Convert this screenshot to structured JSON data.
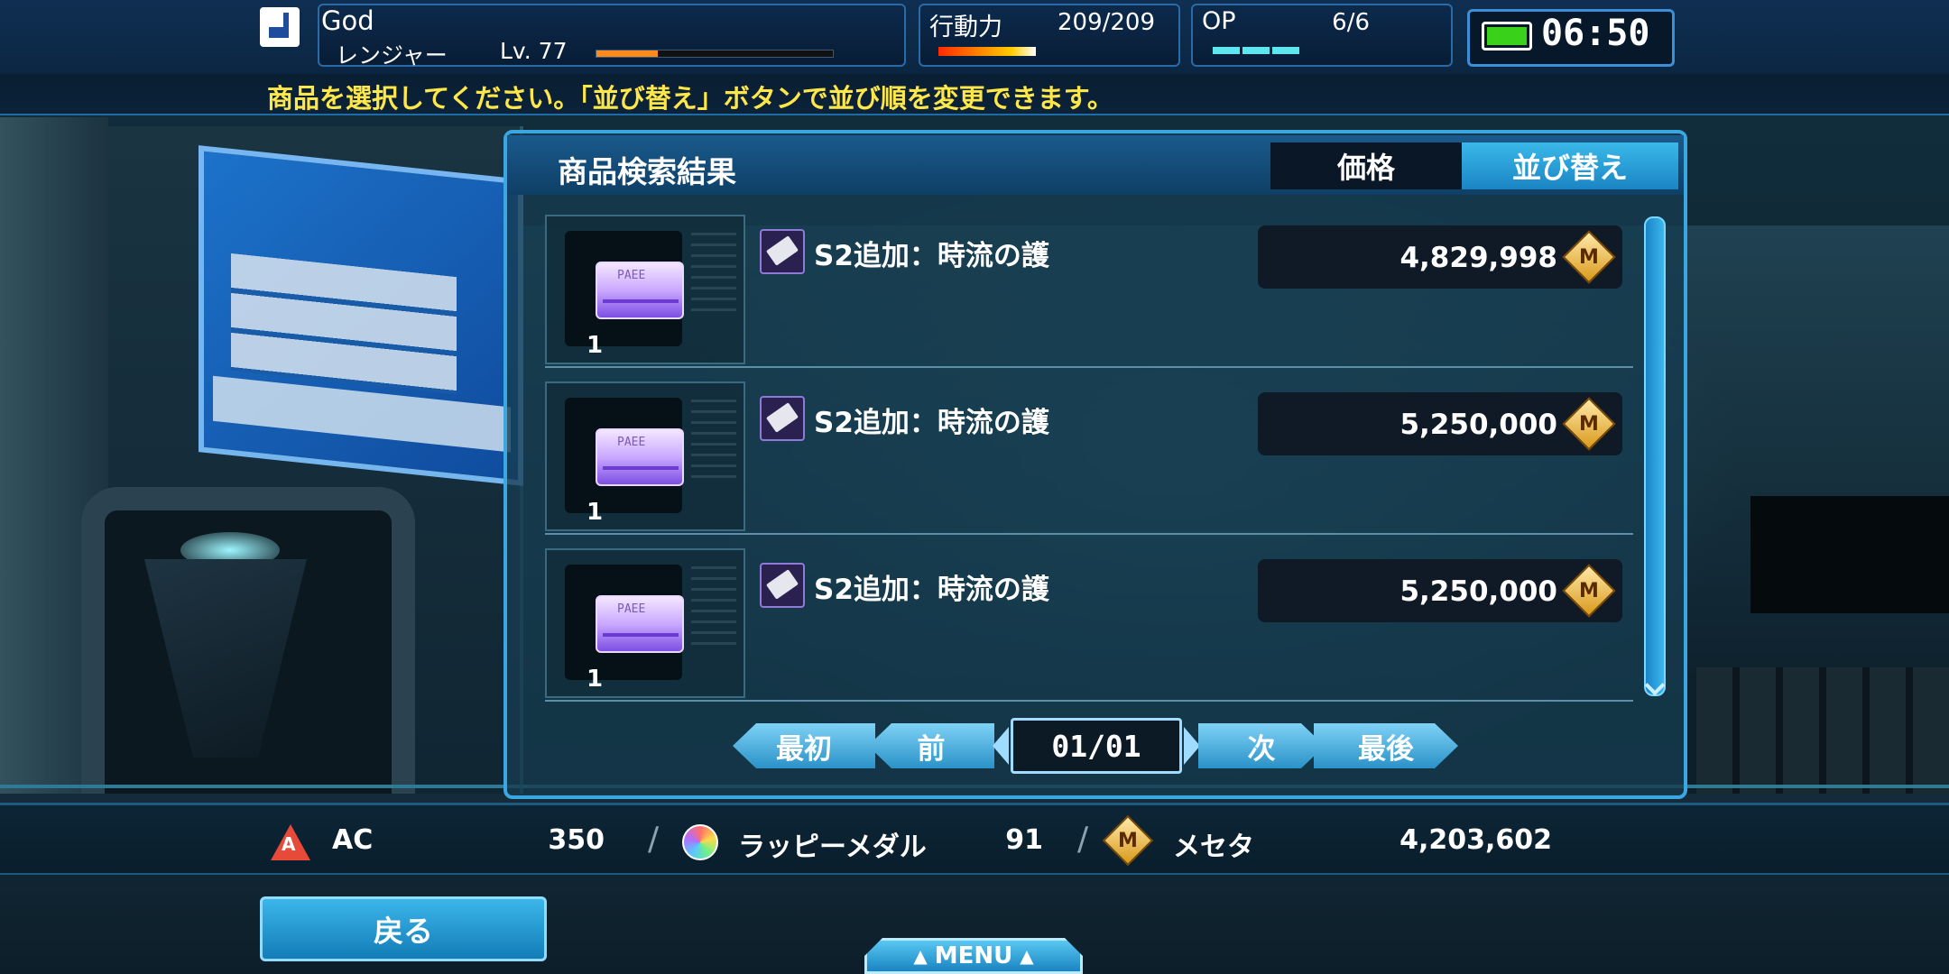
{
  "header": {
    "player_name": "God",
    "player_class": "レンジャー",
    "player_level": "Lv. 77",
    "xp_fraction": 0.26,
    "action_label": "行動力",
    "action_value": "209/209",
    "op_label": "OP",
    "op_value": "6/6",
    "clock": "06:50"
  },
  "instruction": "商品を選択してください。「並び替え」ボタンで並び順を変更できます。",
  "panel": {
    "title": "商品検索結果",
    "sort_current": "価格",
    "sort_button": "並び替え"
  },
  "items": [
    {
      "qty": "1",
      "name": "S2追加：時流の護",
      "price": "4,829,998",
      "card_text": "PAEE"
    },
    {
      "qty": "1",
      "name": "S2追加：時流の護",
      "price": "5,250,000",
      "card_text": "PAEE"
    },
    {
      "qty": "1",
      "name": "S2追加：時流の護",
      "price": "5,250,000",
      "card_text": "PAEE"
    }
  ],
  "pager": {
    "first": "最初",
    "prev": "前",
    "page": "01/01",
    "next": "次",
    "last": "最後"
  },
  "currency": {
    "ac_label": "AC",
    "ac_value": "350",
    "medal_label": "ラッピーメダル",
    "medal_value": "91",
    "meseta_label": "メセタ",
    "meseta_value": "4,203,602",
    "meseta_symbol": "M",
    "ac_symbol": "A"
  },
  "bottom": {
    "back": "戻る",
    "menu": "MENU",
    "menu_arrow": "▲"
  },
  "colors": {
    "accent": "#3aa6e2",
    "instruction_text": "#ffe74a",
    "xp_fill": "#ff8a1c"
  }
}
